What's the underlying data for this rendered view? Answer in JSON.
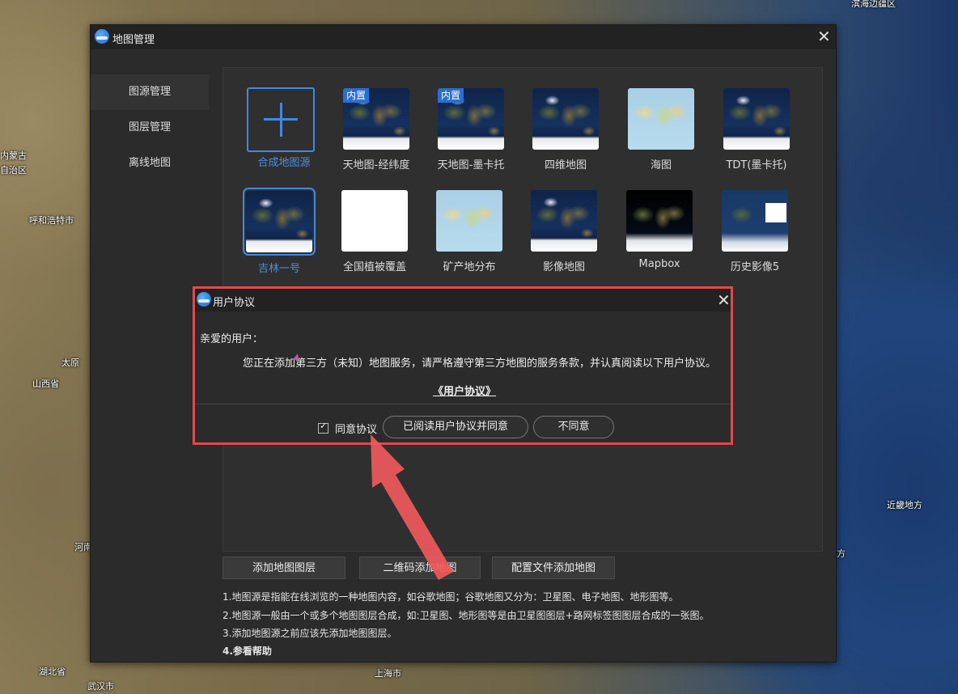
{
  "background_labels": [
    "滨海边疆区",
    "内蒙古",
    "自治区",
    "呼和浩特市",
    "太原",
    "山西省",
    "河南",
    "湖北省",
    "武汉市",
    "上海市",
    "近畿地方",
    "方"
  ],
  "main_window": {
    "title": "地图管理",
    "sidebar": [
      {
        "label": "图源管理"
      },
      {
        "label": "图层管理"
      },
      {
        "label": "离线地图"
      }
    ],
    "tiles_row1": [
      {
        "label": "合成地图源"
      },
      {
        "label": "天地图-经纬度",
        "badge": "内置"
      },
      {
        "label": "天地图-墨卡托",
        "badge": "内置"
      },
      {
        "label": "四维地图"
      },
      {
        "label": "海图"
      },
      {
        "label": "TDT(墨卡托)"
      }
    ],
    "tiles_row2": [
      {
        "label": "吉林一号"
      },
      {
        "label": "全国植被覆盖"
      },
      {
        "label": "矿产地分布"
      },
      {
        "label": "影像地图"
      },
      {
        "label": "Mapbox"
      },
      {
        "label": "历史影像5"
      }
    ],
    "buttons": {
      "add_layer": "添加地图图层",
      "qr_add": "二维码添加地图",
      "config_add": "配置文件添加地图"
    },
    "notes": [
      "1.地图源是指能在线浏览的一种地图内容，如谷歌地图；谷歌地图又分为：卫星图、电子地图、地形图等。",
      "2.地图源一般由一个或多个地图图层合成，如:卫星图、地形图等是由卫星图图层+路网标签图图层合成的一张图。",
      "3.添加地图源之前应该先添加地图图层。",
      "4.参看帮助"
    ]
  },
  "dialog": {
    "title": "用户协议",
    "greeting": "亲爱的用户：",
    "message": "您正在添加第三方（未知）地图服务，请严格遵守第三方地图的服务条款，并认真阅读以下用户协议。",
    "agreement_link": "《用户协议》",
    "checkbox_label": "同意协议",
    "checkbox_checked": true,
    "agree_button": "已阅读用户协议并同意",
    "disagree_button": "不同意"
  },
  "colors": {
    "accent": "#3e8ae6",
    "highlight_border": "#e4484a",
    "arrow": "#f05a5c"
  }
}
